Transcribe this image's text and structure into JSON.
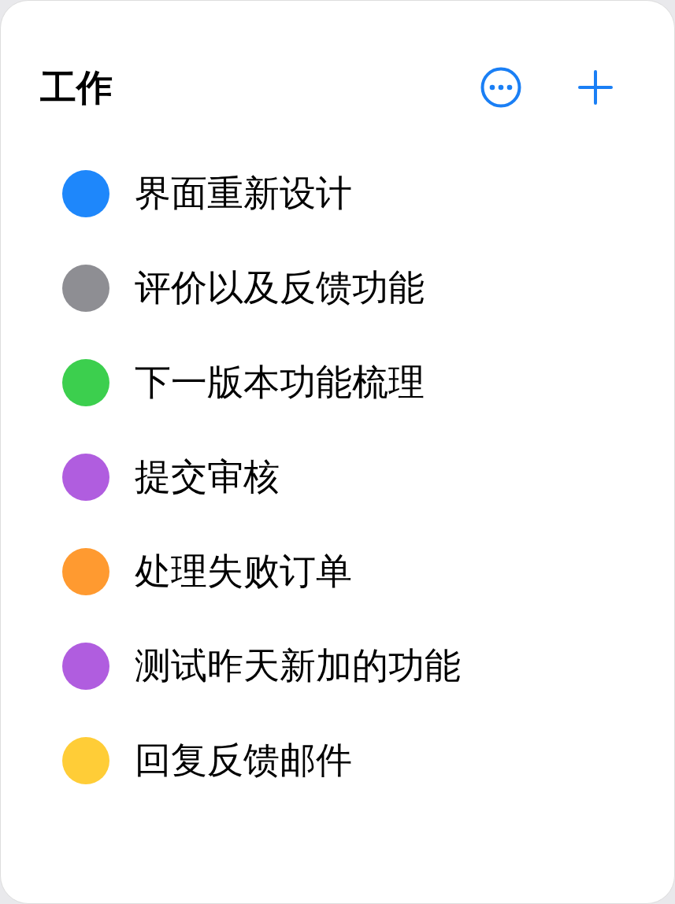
{
  "header": {
    "title": "工作"
  },
  "items": [
    {
      "label": "界面重新设计",
      "color": "#1e87fb"
    },
    {
      "label": "评价以及反馈功能",
      "color": "#8e8e93"
    },
    {
      "label": "下一版本功能梳理",
      "color": "#3ccf4e"
    },
    {
      "label": "提交审核",
      "color": "#b05ddf"
    },
    {
      "label": "处理失败订单",
      "color": "#ff9a30"
    },
    {
      "label": "测试昨天新加的功能",
      "color": "#b05ddf"
    },
    {
      "label": "回复反馈邮件",
      "color": "#ffcd37"
    }
  ]
}
